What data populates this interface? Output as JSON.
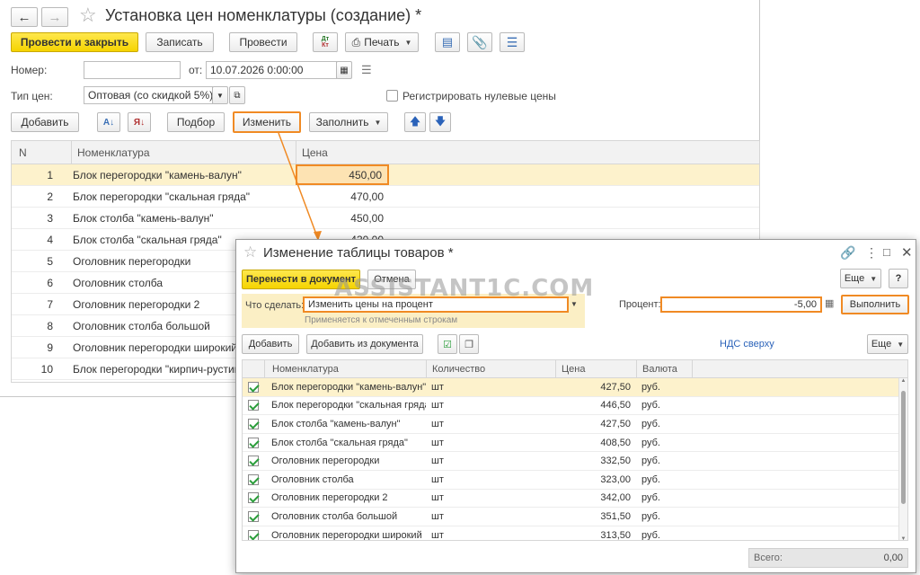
{
  "main": {
    "title": "Установка цен номенклатуры (создание) *",
    "toolbar": {
      "post_close": "Провести и закрыть",
      "save": "Записать",
      "post": "Провести",
      "dtkt": "Дт/Кт",
      "print": "Печать"
    },
    "form": {
      "number_label": "Номер:",
      "number_value": "",
      "date_label": "от:",
      "date_value": "10.07.2026  0:00:00",
      "price_type_label": "Тип цен:",
      "price_type_value": "Оптовая (со скидкой 5%)",
      "zero_prices_label": "Регистрировать нулевые цены"
    },
    "table_toolbar": {
      "add": "Добавить",
      "select": "Подбор",
      "change": "Изменить",
      "fill": "Заполнить"
    },
    "table": {
      "columns": [
        "N",
        "Номенклатура",
        "Цена"
      ],
      "rows": [
        {
          "n": "1",
          "name": "Блок перегородки \"камень-валун\"",
          "price": "450,00"
        },
        {
          "n": "2",
          "name": "Блок перегородки \"скальная гряда\"",
          "price": "470,00"
        },
        {
          "n": "3",
          "name": "Блок столба \"камень-валун\"",
          "price": "450,00"
        },
        {
          "n": "4",
          "name": "Блок столба \"скальная гряда\"",
          "price": "430,00"
        },
        {
          "n": "5",
          "name": "Оголовник перегородки",
          "price": ""
        },
        {
          "n": "6",
          "name": "Оголовник столба",
          "price": ""
        },
        {
          "n": "7",
          "name": "Оголовник перегородки 2",
          "price": ""
        },
        {
          "n": "8",
          "name": "Оголовник столба большой",
          "price": ""
        },
        {
          "n": "9",
          "name": "Оголовник перегородки широкий",
          "price": ""
        },
        {
          "n": "10",
          "name": "Блок перегородки \"кирпич-рустик\"",
          "price": ""
        }
      ]
    }
  },
  "dialog": {
    "title": "Изменение таблицы товаров *",
    "more": "Еще",
    "help": "?",
    "transfer": "Перенести в документ",
    "cancel": "Отмена",
    "action_label": "Что сделать:",
    "action_value": "Изменить цены на процент",
    "action_hint": "Применяется к отмеченным строкам",
    "percent_label": "Процент:",
    "percent_value": "-5,00",
    "execute": "Выполнить",
    "add": "Добавить",
    "add_from_doc": "Добавить из документа",
    "vat_link": "НДС сверху",
    "more2": "Еще",
    "columns": [
      "Номенклатура",
      "Количество",
      "Цена",
      "Валюта"
    ],
    "rows": [
      {
        "name": "Блок перегородки \"камень-валун\"",
        "unit": "шт",
        "price": "427,50",
        "currency": "руб."
      },
      {
        "name": "Блок перегородки \"скальная гряда\"",
        "unit": "шт",
        "price": "446,50",
        "currency": "руб."
      },
      {
        "name": "Блок столба \"камень-валун\"",
        "unit": "шт",
        "price": "427,50",
        "currency": "руб."
      },
      {
        "name": "Блок столба \"скальная гряда\"",
        "unit": "шт",
        "price": "408,50",
        "currency": "руб."
      },
      {
        "name": "Оголовник перегородки",
        "unit": "шт",
        "price": "332,50",
        "currency": "руб."
      },
      {
        "name": "Оголовник столба",
        "unit": "шт",
        "price": "323,00",
        "currency": "руб."
      },
      {
        "name": "Оголовник перегородки 2",
        "unit": "шт",
        "price": "342,00",
        "currency": "руб."
      },
      {
        "name": "Оголовник столба большой",
        "unit": "шт",
        "price": "351,50",
        "currency": "руб."
      },
      {
        "name": "Оголовник перегородки широкий",
        "unit": "шт",
        "price": "313,50",
        "currency": "руб."
      }
    ],
    "total_label": "Всего:",
    "total_value": "0,00"
  },
  "watermark": "ASSISTANT1C.COM",
  "colors": {
    "accent_yellow": "#f5d400",
    "highlight_orange": "#f08a24",
    "selected_row": "#fdf2cc",
    "link_blue": "#2a62b9",
    "check_green": "#2a9d3a"
  }
}
